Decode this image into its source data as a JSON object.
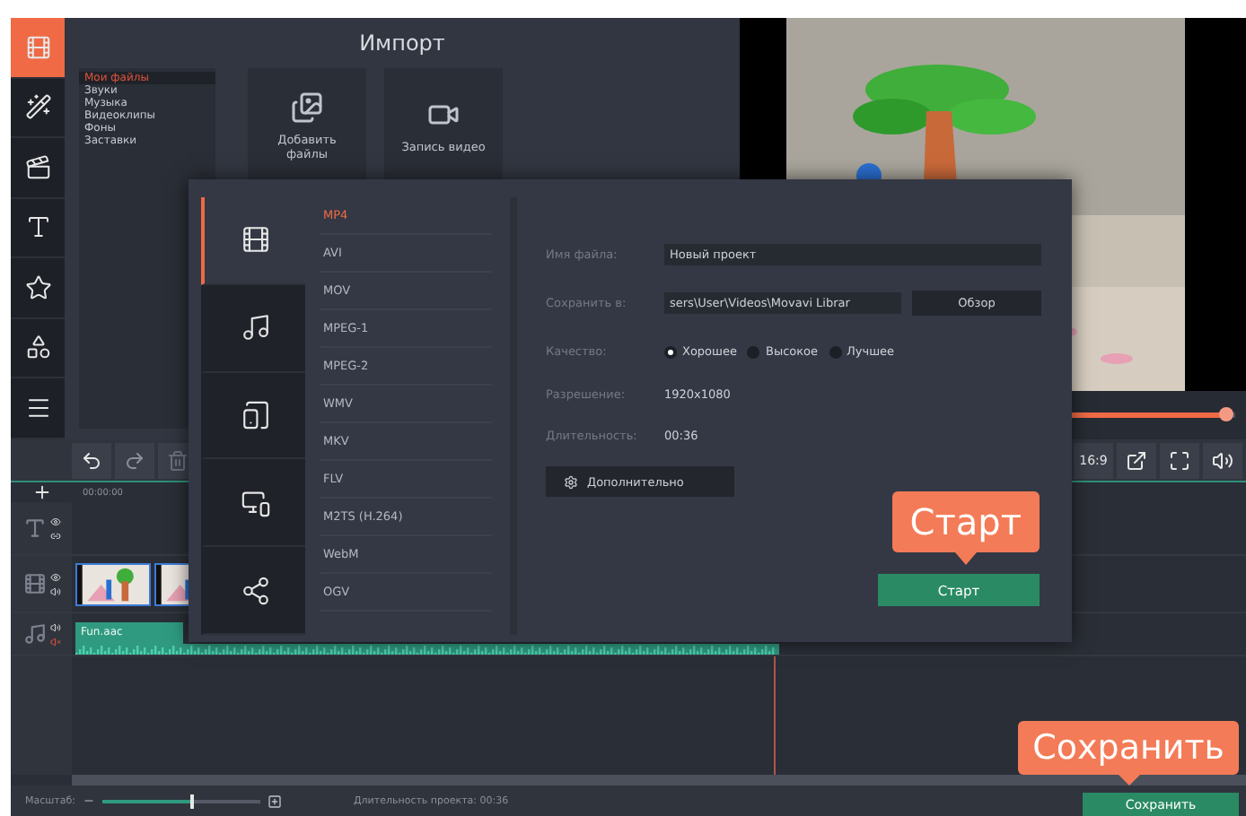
{
  "sidebar": {
    "items": [
      {
        "kind": "media",
        "selected": true
      },
      {
        "kind": "filters",
        "selected": false
      },
      {
        "kind": "transitions",
        "selected": false
      },
      {
        "kind": "titles",
        "selected": false
      },
      {
        "kind": "stickers",
        "selected": false
      },
      {
        "kind": "shapes",
        "selected": false
      },
      {
        "kind": "more",
        "selected": false
      }
    ]
  },
  "import_panel": {
    "title": "Импорт",
    "categories": [
      {
        "label": "Мои файлы",
        "selected": true
      },
      {
        "label": "Звуки",
        "selected": false
      },
      {
        "label": "Музыка",
        "selected": false
      },
      {
        "label": "Видеоклипы",
        "selected": false
      },
      {
        "label": "Фоны",
        "selected": false
      },
      {
        "label": "Заставки",
        "selected": false
      }
    ],
    "tiles": [
      {
        "kind": "add_files",
        "label": "Добавить файлы"
      },
      {
        "kind": "record",
        "label": "Запись видео"
      }
    ]
  },
  "player": {
    "progress": {
      "level": 0.98
    },
    "aspect": "16:9"
  },
  "timeline": {
    "ruler": [
      "00:00:00"
    ],
    "tracks": [
      {
        "kind": "titles"
      },
      {
        "kind": "video"
      },
      {
        "kind": "audio",
        "clip": "Fun.aac"
      }
    ]
  },
  "export_dialog": {
    "categories": [
      {
        "kind": "video",
        "selected": true
      },
      {
        "kind": "audio",
        "selected": false
      },
      {
        "kind": "devices",
        "selected": false
      },
      {
        "kind": "tv",
        "selected": false
      },
      {
        "kind": "share",
        "selected": false
      }
    ],
    "formats": [
      {
        "label": "MP4",
        "selected": true
      },
      {
        "label": "AVI",
        "selected": false
      },
      {
        "label": "MOV",
        "selected": false
      },
      {
        "label": "MPEG-1",
        "selected": false
      },
      {
        "label": "MPEG-2",
        "selected": false
      },
      {
        "label": "WMV",
        "selected": false
      },
      {
        "label": "MKV",
        "selected": false
      },
      {
        "label": "FLV",
        "selected": false
      },
      {
        "label": "M2TS (H.264)",
        "selected": false
      },
      {
        "label": "WebM",
        "selected": false
      },
      {
        "label": "OGV",
        "selected": false
      }
    ],
    "file_name": {
      "label": "Имя файла:",
      "value": "Новый проект"
    },
    "save_to": {
      "label": "Сохранить в:",
      "value": "sers\\User\\Videos\\Movavi Librar",
      "browse": "Обзор"
    },
    "quality": {
      "label": "Качество:",
      "options": [
        {
          "label": "Хорошее",
          "selected": true
        },
        {
          "label": "Высокое",
          "selected": false
        },
        {
          "label": "Лучшее",
          "selected": false
        }
      ]
    },
    "resolution": {
      "label": "Разрешение:",
      "value": "1920x1080"
    },
    "duration": {
      "label": "Длительность:",
      "value": "00:36"
    },
    "advanced_button": "Дополнительно",
    "start_hint": "Старт",
    "start_button": "Старт"
  },
  "status_bar": {
    "zoom_label": "Масштаб:",
    "zoom": {
      "level": 0.56
    },
    "project_duration": "Длительность проекта: 00:36",
    "save_hint": "Сохранить",
    "save_button": "Сохранить"
  }
}
